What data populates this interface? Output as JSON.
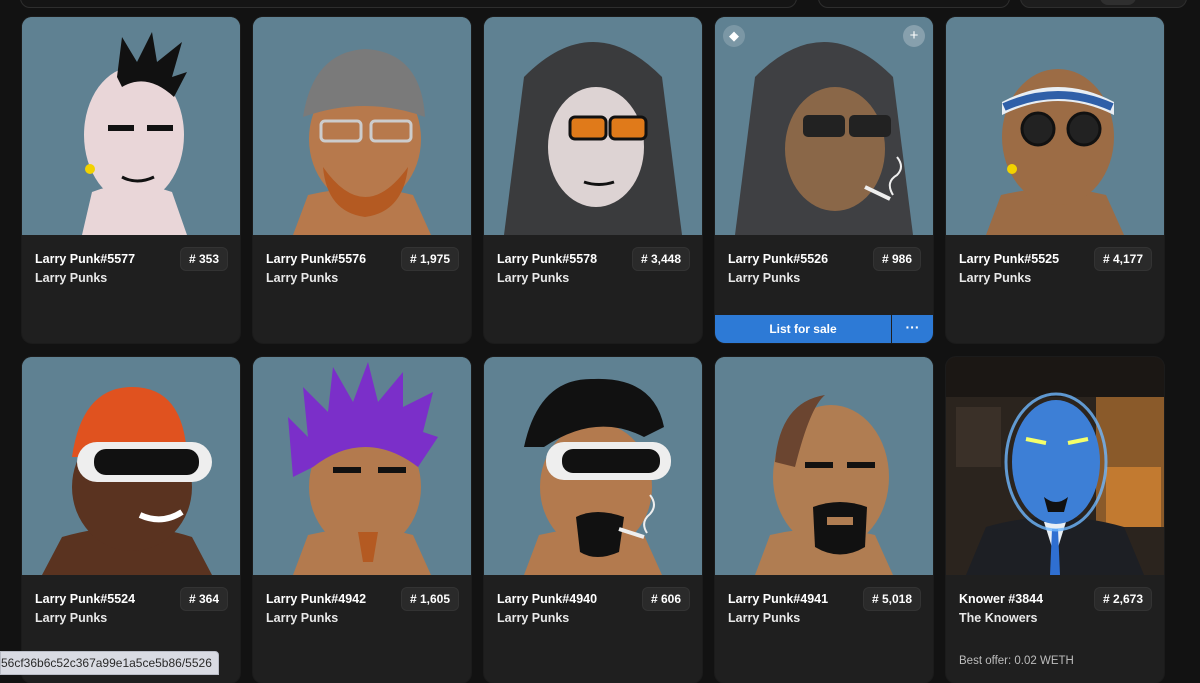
{
  "cards": [
    {
      "name": "Larry Punk#5577",
      "collection": "Larry Punks",
      "rank": "# 353",
      "art": "punk-mohawk-avatar"
    },
    {
      "name": "Larry Punk#5576",
      "collection": "Larry Punks",
      "rank": "# 1,975",
      "art": "punk-bandana-glasses-avatar"
    },
    {
      "name": "Larry Punk#5578",
      "collection": "Larry Punks",
      "rank": "# 3,448",
      "art": "punk-hoodie-orange-shades-avatar"
    },
    {
      "name": "Larry Punk#5526",
      "collection": "Larry Punks",
      "rank": "# 986",
      "art": "punk-hoodie-cigarette-avatar",
      "list_label": "List for sale",
      "more_label": "···",
      "eth_icon": "ethereum-icon",
      "plus_icon": "plus-icon"
    },
    {
      "name": "Larry Punk#5525",
      "collection": "Larry Punks",
      "rank": "# 4,177",
      "art": "punk-headband-round-glasses-avatar"
    },
    {
      "name": "Larry Punk#5524",
      "collection": "Larry Punks",
      "rank": "# 364",
      "art": "punk-beanie-vr-avatar"
    },
    {
      "name": "Larry Punk#4942",
      "collection": "Larry Punks",
      "rank": "# 1,605",
      "art": "punk-purple-hair-avatar"
    },
    {
      "name": "Larry Punk#4940",
      "collection": "Larry Punks",
      "rank": "# 606",
      "art": "punk-vr-cigarette-avatar"
    },
    {
      "name": "Larry Punk#4941",
      "collection": "Larry Punks",
      "rank": "# 5,018",
      "art": "punk-bald-goatee-avatar"
    },
    {
      "name": "Knower #3844",
      "collection": "The Knowers",
      "rank": "# 2,673",
      "art": "knower-blue-figure-avatar",
      "best_offer": "Best offer: 0.02 WETH"
    }
  ],
  "status_url": "56cf36b6c52c367a99e1a5ce5b86/5526",
  "colors": {
    "card_bg": "#1f1f1f",
    "art_bg": "#5f8192",
    "accent": "#2d7ad6",
    "page_bg": "#121212"
  }
}
